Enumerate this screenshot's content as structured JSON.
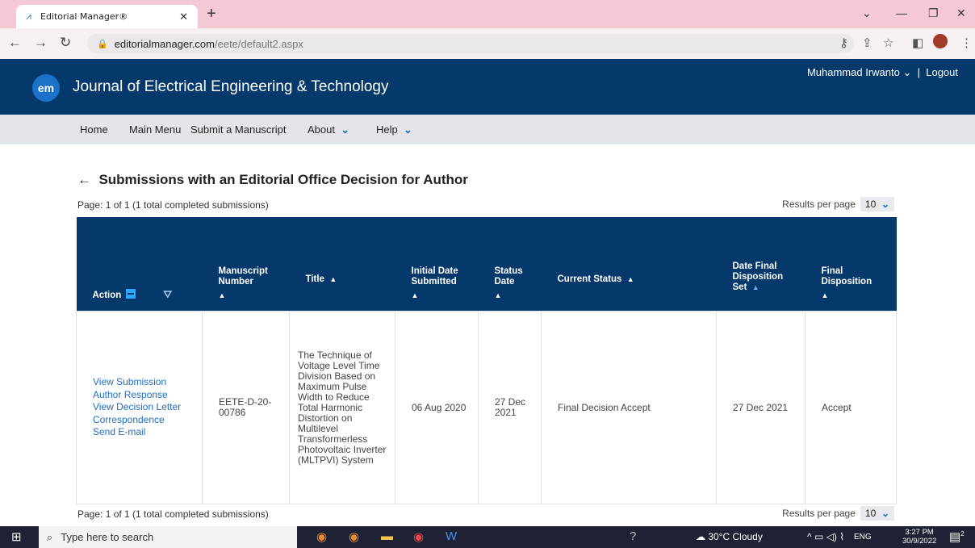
{
  "browser": {
    "tab_title": "Editorial Manager®",
    "url_host": "editorialmanager.com",
    "url_path": "/eete/default2.aspx"
  },
  "header": {
    "logo": "em",
    "journal_title": "Journal of Electrical Engineering & Technology",
    "user_name": "Muhammad Irwanto",
    "logout": "Logout"
  },
  "menu": {
    "home": "Home",
    "main_menu": "Main Menu",
    "submit": "Submit a Manuscript",
    "about": "About",
    "help": "Help"
  },
  "page": {
    "title": "Submissions with an Editorial Office Decision for Author",
    "page_info": "Page: 1 of 1 (1 total completed submissions)",
    "results_per_page_label": "Results per page",
    "results_per_page_value": "10"
  },
  "table": {
    "headers": {
      "action": "Action",
      "manuscript_number": "Manuscript Number",
      "title": "Title",
      "initial_date": "Initial Date Submitted",
      "status_date": "Status Date",
      "current_status": "Current Status",
      "date_final": "Date Final Disposition Set",
      "final_disposition": "Final Disposition"
    },
    "row": {
      "actions": [
        "View Submission",
        "Author Response",
        "View Decision Letter",
        "Correspondence",
        "Send E-mail"
      ],
      "manuscript_number": "EETE-D-20-00786",
      "title": "The Technique of Voltage Level Time Division Based on Maximum Pulse Width to Reduce Total Harmonic Distortion on Multilevel Transformerless Photovoltaic Inverter (MLTPVI) System",
      "initial_date": "06 Aug 2020",
      "status_date": "27 Dec 2021",
      "current_status": "Final Decision Accept",
      "date_final": "27 Dec 2021",
      "final_disposition": "Accept"
    }
  },
  "taskbar": {
    "search_placeholder": "Type here to search",
    "weather": "30°C  Cloudy",
    "lang": "ENG",
    "time": "3:27 PM",
    "date": "30/9/2022",
    "notif_count": "2"
  }
}
